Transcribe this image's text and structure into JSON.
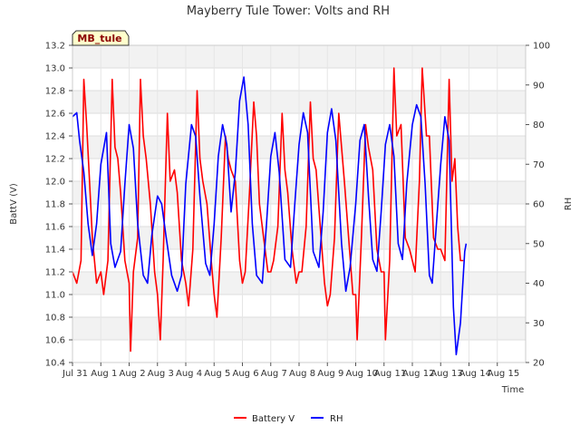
{
  "chart_data": {
    "type": "line",
    "title": "Mayberry Tule Tower: Volts and RH",
    "station_label": "MB_tule",
    "xlabel": "Time",
    "ylabel_left": "BattV (V)",
    "ylabel_right": "RH",
    "xlim": [
      0,
      16
    ],
    "ylim_left": [
      10.4,
      13.2
    ],
    "ylim_right": [
      20,
      100
    ],
    "x_tick_labels": [
      "Jul 31",
      "Aug 1",
      "Aug 2",
      "Aug 3",
      "Aug 4",
      "Aug 5",
      "Aug 6",
      "Aug 7",
      "Aug 8",
      "Aug 9",
      "Aug 10",
      "Aug 11",
      "Aug 12",
      "Aug 13",
      "Aug 14",
      "Aug 15"
    ],
    "y_left_ticks": [
      "10.4",
      "10.6",
      "10.8",
      "11.0",
      "11.2",
      "11.4",
      "11.6",
      "11.8",
      "12.0",
      "12.2",
      "12.4",
      "12.6",
      "12.8",
      "13.0",
      "13.2"
    ],
    "y_right_ticks": [
      "20",
      "30",
      "40",
      "50",
      "60",
      "70",
      "80",
      "90",
      "100"
    ],
    "grid": true,
    "legend_position": "bottom-center",
    "series": [
      {
        "name": "Battery V",
        "axis": "left",
        "color": "#ff0000",
        "points": [
          [
            0.0,
            11.2
          ],
          [
            0.15,
            11.1
          ],
          [
            0.3,
            11.3
          ],
          [
            0.4,
            12.9
          ],
          [
            0.5,
            12.5
          ],
          [
            0.6,
            12.0
          ],
          [
            0.7,
            11.5
          ],
          [
            0.85,
            11.1
          ],
          [
            1.0,
            11.2
          ],
          [
            1.1,
            11.0
          ],
          [
            1.25,
            11.3
          ],
          [
            1.4,
            12.9
          ],
          [
            1.5,
            12.3
          ],
          [
            1.6,
            12.2
          ],
          [
            1.7,
            11.9
          ],
          [
            1.85,
            11.3
          ],
          [
            2.0,
            11.1
          ],
          [
            2.05,
            10.5
          ],
          [
            2.15,
            11.2
          ],
          [
            2.3,
            11.5
          ],
          [
            2.4,
            12.9
          ],
          [
            2.5,
            12.4
          ],
          [
            2.6,
            12.2
          ],
          [
            2.75,
            11.8
          ],
          [
            2.9,
            11.2
          ],
          [
            3.0,
            11.0
          ],
          [
            3.1,
            10.6
          ],
          [
            3.2,
            11.3
          ],
          [
            3.35,
            12.6
          ],
          [
            3.45,
            12.0
          ],
          [
            3.6,
            12.1
          ],
          [
            3.7,
            11.9
          ],
          [
            3.85,
            11.3
          ],
          [
            4.0,
            11.1
          ],
          [
            4.1,
            10.9
          ],
          [
            4.25,
            11.4
          ],
          [
            4.4,
            12.8
          ],
          [
            4.5,
            12.2
          ],
          [
            4.6,
            12.0
          ],
          [
            4.75,
            11.8
          ],
          [
            4.9,
            11.3
          ],
          [
            5.0,
            11.0
          ],
          [
            5.1,
            10.8
          ],
          [
            5.25,
            11.5
          ],
          [
            5.4,
            12.4
          ],
          [
            5.5,
            12.2
          ],
          [
            5.6,
            12.1
          ],
          [
            5.75,
            12.0
          ],
          [
            5.9,
            11.3
          ],
          [
            6.0,
            11.1
          ],
          [
            6.1,
            11.2
          ],
          [
            6.25,
            11.9
          ],
          [
            6.4,
            12.7
          ],
          [
            6.5,
            12.4
          ],
          [
            6.6,
            11.8
          ],
          [
            6.75,
            11.5
          ],
          [
            6.9,
            11.2
          ],
          [
            7.0,
            11.2
          ],
          [
            7.1,
            11.3
          ],
          [
            7.25,
            11.6
          ],
          [
            7.4,
            12.6
          ],
          [
            7.5,
            12.1
          ],
          [
            7.6,
            11.9
          ],
          [
            7.75,
            11.4
          ],
          [
            7.9,
            11.1
          ],
          [
            8.0,
            11.2
          ],
          [
            8.1,
            11.2
          ],
          [
            8.25,
            11.6
          ],
          [
            8.4,
            12.7
          ],
          [
            8.5,
            12.2
          ],
          [
            8.6,
            12.1
          ],
          [
            8.75,
            11.6
          ],
          [
            8.9,
            11.1
          ],
          [
            9.0,
            10.9
          ],
          [
            9.1,
            11.0
          ],
          [
            9.25,
            11.5
          ],
          [
            9.4,
            12.6
          ],
          [
            9.5,
            12.3
          ],
          [
            9.6,
            12.0
          ],
          [
            9.75,
            11.5
          ],
          [
            9.9,
            11.0
          ],
          [
            10.0,
            11.0
          ],
          [
            10.05,
            10.6
          ],
          [
            10.2,
            11.5
          ],
          [
            10.35,
            12.5
          ],
          [
            10.45,
            12.3
          ],
          [
            10.6,
            12.1
          ],
          [
            10.75,
            11.4
          ],
          [
            10.9,
            11.2
          ],
          [
            11.0,
            11.2
          ],
          [
            11.05,
            10.6
          ],
          [
            11.2,
            11.3
          ],
          [
            11.35,
            13.0
          ],
          [
            11.45,
            12.4
          ],
          [
            11.6,
            12.5
          ],
          [
            11.75,
            11.5
          ],
          [
            11.9,
            11.4
          ],
          [
            12.0,
            11.3
          ],
          [
            12.1,
            11.2
          ],
          [
            12.25,
            12.0
          ],
          [
            12.35,
            13.0
          ],
          [
            12.5,
            12.4
          ],
          [
            12.6,
            12.4
          ],
          [
            12.75,
            11.5
          ],
          [
            12.9,
            11.4
          ],
          [
            13.0,
            11.4
          ],
          [
            13.15,
            11.3
          ],
          [
            13.3,
            12.9
          ],
          [
            13.4,
            12.0
          ],
          [
            13.5,
            12.2
          ],
          [
            13.6,
            11.6
          ],
          [
            13.7,
            11.3
          ],
          [
            13.8,
            11.3
          ]
        ]
      },
      {
        "name": "RH",
        "axis": "right",
        "color": "#0000ff",
        "points": [
          [
            0.0,
            82
          ],
          [
            0.15,
            83
          ],
          [
            0.25,
            76
          ],
          [
            0.4,
            68
          ],
          [
            0.55,
            55
          ],
          [
            0.7,
            47
          ],
          [
            0.85,
            55
          ],
          [
            1.0,
            70
          ],
          [
            1.2,
            78
          ],
          [
            1.35,
            50
          ],
          [
            1.5,
            44
          ],
          [
            1.7,
            48
          ],
          [
            1.85,
            65
          ],
          [
            2.0,
            80
          ],
          [
            2.15,
            74
          ],
          [
            2.3,
            55
          ],
          [
            2.5,
            42
          ],
          [
            2.65,
            40
          ],
          [
            2.8,
            52
          ],
          [
            3.0,
            62
          ],
          [
            3.15,
            60
          ],
          [
            3.3,
            52
          ],
          [
            3.5,
            42
          ],
          [
            3.7,
            38
          ],
          [
            3.85,
            42
          ],
          [
            4.0,
            65
          ],
          [
            4.2,
            80
          ],
          [
            4.35,
            77
          ],
          [
            4.5,
            62
          ],
          [
            4.7,
            45
          ],
          [
            4.85,
            42
          ],
          [
            5.0,
            55
          ],
          [
            5.15,
            72
          ],
          [
            5.3,
            80
          ],
          [
            5.45,
            75
          ],
          [
            5.6,
            58
          ],
          [
            5.75,
            68
          ],
          [
            5.9,
            86
          ],
          [
            6.05,
            92
          ],
          [
            6.2,
            80
          ],
          [
            6.35,
            55
          ],
          [
            6.5,
            42
          ],
          [
            6.7,
            40
          ],
          [
            6.85,
            55
          ],
          [
            7.0,
            72
          ],
          [
            7.15,
            78
          ],
          [
            7.3,
            68
          ],
          [
            7.5,
            46
          ],
          [
            7.7,
            44
          ],
          [
            7.85,
            60
          ],
          [
            8.0,
            75
          ],
          [
            8.15,
            83
          ],
          [
            8.3,
            78
          ],
          [
            8.5,
            48
          ],
          [
            8.7,
            44
          ],
          [
            8.85,
            58
          ],
          [
            9.0,
            78
          ],
          [
            9.15,
            84
          ],
          [
            9.3,
            76
          ],
          [
            9.5,
            50
          ],
          [
            9.65,
            38
          ],
          [
            9.8,
            44
          ],
          [
            10.0,
            60
          ],
          [
            10.15,
            76
          ],
          [
            10.3,
            80
          ],
          [
            10.45,
            62
          ],
          [
            10.6,
            46
          ],
          [
            10.75,
            43
          ],
          [
            10.9,
            58
          ],
          [
            11.05,
            75
          ],
          [
            11.2,
            80
          ],
          [
            11.35,
            72
          ],
          [
            11.5,
            50
          ],
          [
            11.65,
            46
          ],
          [
            11.8,
            65
          ],
          [
            12.0,
            80
          ],
          [
            12.15,
            85
          ],
          [
            12.3,
            82
          ],
          [
            12.45,
            65
          ],
          [
            12.6,
            42
          ],
          [
            12.7,
            40
          ],
          [
            12.85,
            55
          ],
          [
            13.0,
            70
          ],
          [
            13.15,
            82
          ],
          [
            13.3,
            76
          ],
          [
            13.45,
            34
          ],
          [
            13.55,
            22
          ],
          [
            13.7,
            30
          ],
          [
            13.85,
            48
          ],
          [
            13.9,
            50
          ]
        ]
      }
    ]
  }
}
